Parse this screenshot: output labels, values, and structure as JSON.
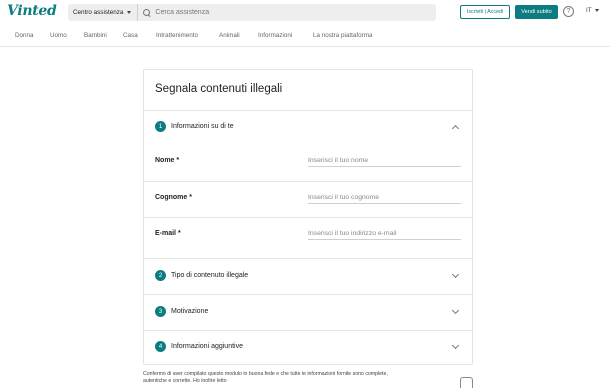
{
  "header": {
    "logo": "Vinted",
    "search_category": "Centro assistenza",
    "search_placeholder": "Cerca assistenza",
    "login_button": "Iscriviti | Accedi",
    "sell_button": "Vendi subito",
    "help_icon_glyph": "?",
    "language": "IT"
  },
  "categories": [
    "Donna",
    "Uomo",
    "Bambini",
    "Casa",
    "Intrattenimento",
    "Animali",
    "Informazioni",
    "La nostra piattaforma"
  ],
  "form": {
    "title": "Segnala contenuti illegali",
    "sections": [
      {
        "number": "1",
        "title": "Informazioni su di te",
        "expanded": true
      },
      {
        "number": "2",
        "title": "Tipo di contenuto illegale",
        "expanded": false
      },
      {
        "number": "3",
        "title": "Motivazione",
        "expanded": false
      },
      {
        "number": "4",
        "title": "Informazioni aggiuntive",
        "expanded": false
      }
    ],
    "fields": [
      {
        "label": "Nome *",
        "placeholder": "Inserisci il tuo nome",
        "value": ""
      },
      {
        "label": "Cognome *",
        "placeholder": "Inserisci il tuo cognome",
        "value": ""
      },
      {
        "label": "E-mail *",
        "placeholder": "Inserisci il tuo indirizzo e-mail",
        "value": ""
      }
    ]
  },
  "confirm": {
    "line1": "Confermo di aver compilato questo modulo in buona fede e che tutte le informazioni fornite sono complete,",
    "line2": "autentiche e corrette. Ho inoltre letto"
  },
  "colors": {
    "accent": "#0b7c7f"
  }
}
